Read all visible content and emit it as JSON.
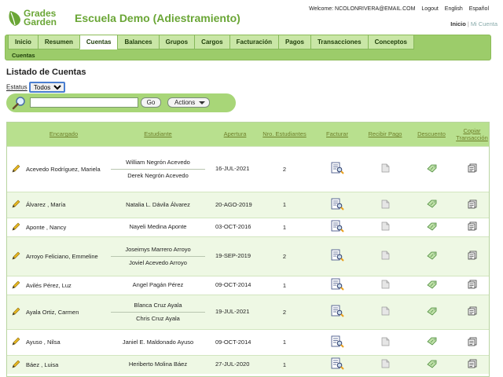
{
  "brand": {
    "line1": "Grades",
    "line2": "Garden"
  },
  "school_name": "Escuela Demo (Adiestramiento)",
  "top_links": {
    "welcome": "Welcome: NCOLONRIVERA@EMAIL.COM",
    "logout": "Logout",
    "english": "English",
    "espanol": "Español"
  },
  "user_links": {
    "inicio": "Inicio",
    "separator": "|",
    "mi_cuenta": "Mi Cuenta"
  },
  "nav": {
    "tabs": [
      "Inicio",
      "Resumen",
      "Cuentas",
      "Balances",
      "Grupos",
      "Cargos",
      "Facturación",
      "Pagos",
      "Transacciones",
      "Conceptos"
    ],
    "active": "Cuentas",
    "breadcrumb": "Cuentas"
  },
  "page_title": "Listado de Cuentas",
  "filter": {
    "label": "Estatus",
    "selected": "Todos"
  },
  "search": {
    "value": "",
    "go_label": "Go",
    "actions_label": "Actions"
  },
  "table": {
    "headers": {
      "encargado": "Encargado",
      "estudiante": "Estudiante",
      "apertura": "Apertura",
      "nro": "Nro. Estudiantes",
      "facturar": "Facturar",
      "recibir": "Recibir Pago",
      "descuento": "Descuento",
      "copiar": "Copiar Transacción"
    },
    "rows": [
      {
        "encargado": "Acevedo Rodríguez, Mariela",
        "students": [
          "William Negrón Acevedo",
          "Derek Negrón Acevedo"
        ],
        "apertura": "16-JUL-2021",
        "nro": "2"
      },
      {
        "encargado": "Álvarez , María",
        "students": [
          "Natalia L. Dávila Álvarez"
        ],
        "apertura": "20-AGO-2019",
        "nro": "1"
      },
      {
        "encargado": "Aponte , Nancy",
        "students": [
          "Nayeli Medina Aponte"
        ],
        "apertura": "03-OCT-2016",
        "nro": "1"
      },
      {
        "encargado": "Arroyo Feliciano, Emmeline",
        "students": [
          "Joseimys Marrero Arroyo",
          "Joviel Acevedo Arroyo"
        ],
        "apertura": "19-SEP-2019",
        "nro": "2"
      },
      {
        "encargado": "Avilés Pérez, Luz",
        "students": [
          "Angel Pagán Pérez"
        ],
        "apertura": "09-OCT-2014",
        "nro": "1"
      },
      {
        "encargado": "Ayala Ortiz, Carmen",
        "students": [
          "Blanca Cruz Ayala",
          "Chris Cruz Ayala"
        ],
        "apertura": "19-JUL-2021",
        "nro": "2"
      },
      {
        "encargado": "Ayuso , Nilsa",
        "students": [
          "Janiel E. Maldonado Ayuso"
        ],
        "apertura": "09-OCT-2014",
        "nro": "1"
      },
      {
        "encargado": "Báez , Luisa",
        "students": [
          "Heriberto Molina Báez"
        ],
        "apertura": "27-JUL-2020",
        "nro": "1"
      }
    ]
  },
  "icons": {
    "edit": "pencil-icon",
    "invoice": "invoice-magnifier-icon",
    "receive": "blank-document-icon",
    "discount": "discount-tag-icon",
    "copy": "copy-document-icon"
  },
  "colors": {
    "brand_green": "#6aa636",
    "nav_green": "#9ccc6a",
    "header_green": "#b8e08e",
    "row_alt": "#eef8e4"
  }
}
